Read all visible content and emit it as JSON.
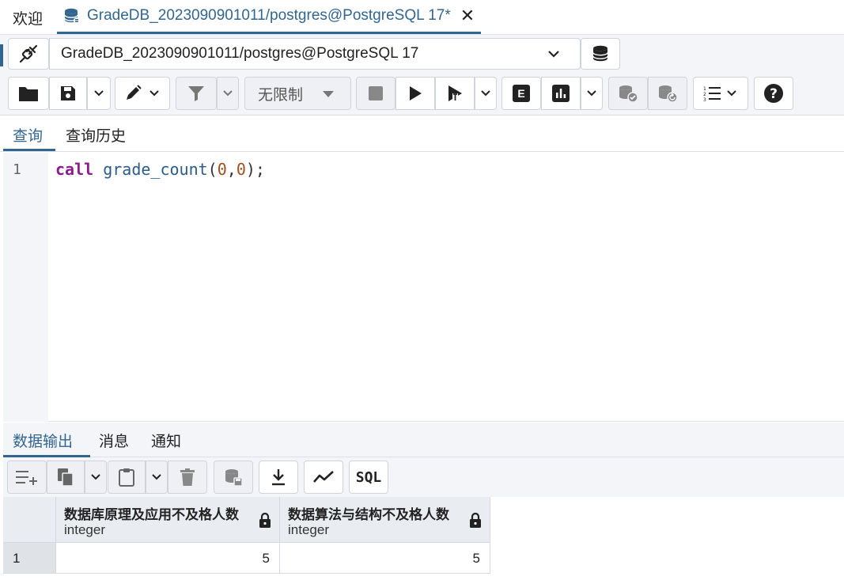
{
  "tabs": {
    "welcome": "欢迎",
    "query_tab_title": "GradeDB_2023090901011/postgres@PostgreSQL 17*",
    "close_symbol": "✕"
  },
  "connection": {
    "selected": "GradeDB_2023090901011/postgres@PostgreSQL 17"
  },
  "toolbar": {
    "limit_label": "无限制",
    "explain_label": "E",
    "sql_label": "SQL"
  },
  "editor_tabs": {
    "query": "查询",
    "history": "查询历史"
  },
  "editor": {
    "line_number": "1",
    "tokens": {
      "keyword": "call",
      "function": "grade_count",
      "open": "(",
      "arg1": "0",
      "comma": ",",
      "arg2": "0",
      "close": ");"
    }
  },
  "result_tabs": {
    "data_output": "数据输出",
    "messages": "消息",
    "notifications": "通知"
  },
  "grid": {
    "columns": [
      {
        "name": "数据库原理及应用不及格人数",
        "type": "integer"
      },
      {
        "name": "数据算法与结构不及格人数",
        "type": "integer"
      }
    ],
    "rows": [
      {
        "row_number": "1",
        "values": [
          "5",
          "5"
        ]
      }
    ]
  },
  "colors": {
    "accent": "#326690",
    "toolbar_bg": "#f3f5f9",
    "keyword": "#8e1a8e",
    "number": "#a04f1e"
  }
}
